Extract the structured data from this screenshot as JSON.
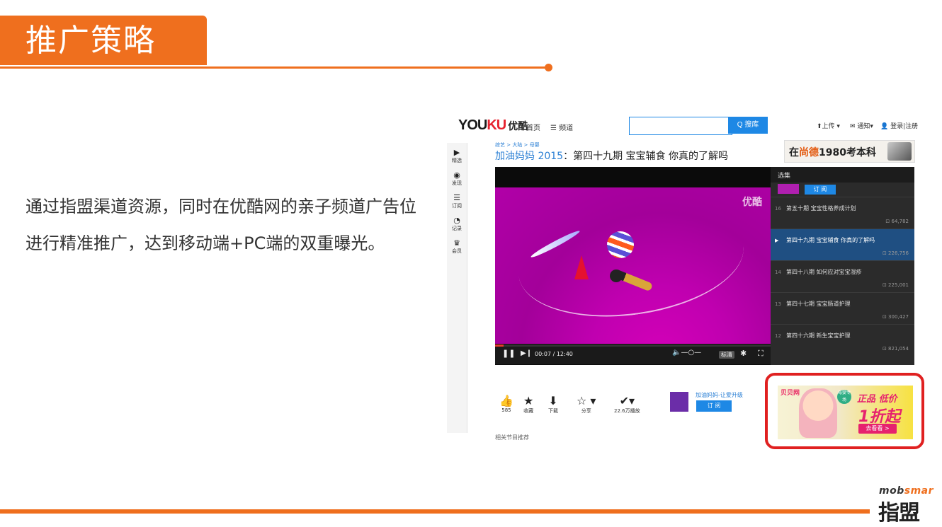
{
  "slide": {
    "title": "推广策略",
    "body": "通过指盟渠道资源，同时在优酷网的亲子频道广告位进行精准推广，达到移动端+PC端的双重曝光。",
    "logo_en_a": "mob",
    "logo_en_b": "smar",
    "logo_cn": "指盟"
  },
  "youku": {
    "logo_a": "YOU",
    "logo_b": "KU",
    "logo_cn": "优酷",
    "nav": [
      "首页",
      "☰ 频道"
    ],
    "search_placeholder": "",
    "search_button": "Q 搜库",
    "right": [
      "⬆上传 ▾",
      "✉ 通知▾",
      "👤 登录|注册"
    ],
    "sidebar": [
      {
        "icon": "▶",
        "label": "精选"
      },
      {
        "icon": "◉",
        "label": "发现"
      },
      {
        "icon": "☰",
        "label": "订阅"
      },
      {
        "icon": "◔",
        "label": "记录"
      },
      {
        "icon": "♛",
        "label": "会员"
      }
    ],
    "breadcrumb": "综艺 > 大陆 > 母婴",
    "title_series": "加油妈妈 2015",
    "title_rest": "：第四十九期 宝宝辅食 你真的了解吗",
    "ad_banner": {
      "a": "在",
      "b": "尚德",
      "c": "1980考本科"
    },
    "watermark": "优酷",
    "time": "00:07 / 12:40",
    "quality": "标清",
    "playlist_tab": "选集",
    "subscribe": "订 阅",
    "playlist": [
      {
        "num": "16",
        "title": "第五十期 宝宝性格养成计划",
        "views": "⊡ 64,782",
        "active": false
      },
      {
        "num": "▶",
        "title": "第四十九期 宝宝辅食 你真的了解吗",
        "views": "⊡ 226,756",
        "active": true
      },
      {
        "num": "14",
        "title": "第四十八期 如何应对宝宝湿疹",
        "views": "⊡ 225,001",
        "active": false
      },
      {
        "num": "13",
        "title": "第四十七期 宝宝肠道护理",
        "views": "⊡ 300,427",
        "active": false
      },
      {
        "num": "12",
        "title": "第四十六期 新生宝宝护理",
        "views": "⊡ 821,054",
        "active": false
      }
    ],
    "actions": [
      {
        "icon": "👍",
        "label": "585"
      },
      {
        "icon": "★",
        "label": "收藏"
      },
      {
        "icon": "⬇",
        "label": "下载"
      },
      {
        "icon": "☆ ▾",
        "label": "分享"
      },
      {
        "icon": "✔▾",
        "label": "22.6万播放"
      }
    ],
    "uploader_name": "加油妈妈-让爱升级",
    "uploader_sub": "订 阅",
    "below_text": "相关节目推荐"
  },
  "ad2": {
    "brand": "贝贝网",
    "badge": "母婴专场",
    "line1": "正品 低价",
    "line2": "1折起",
    "button": "去看看 >"
  }
}
